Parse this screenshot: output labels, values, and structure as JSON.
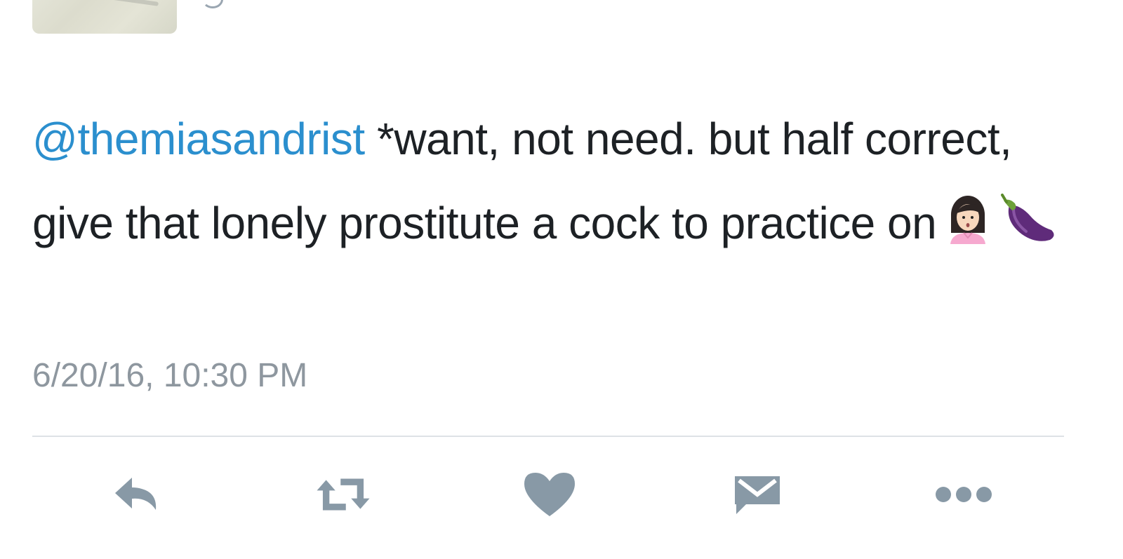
{
  "tweet": {
    "mention": "@themiasandrist",
    "body": " *want, not need. but half correct, give that lonely prostitute a cock to practice on",
    "emojis": [
      "woman-raising-hand-emoji",
      "eggplant-emoji"
    ],
    "timestamp": "6/20/16, 10:30 PM"
  },
  "actions": [
    {
      "icon": "reply-icon"
    },
    {
      "icon": "retweet-icon"
    },
    {
      "icon": "heart-icon"
    },
    {
      "icon": "direct-message-icon"
    },
    {
      "icon": "more-icon"
    }
  ],
  "colors": {
    "mention": "#2b8fce",
    "text": "#1d2125",
    "muted": "#8e979f",
    "icon": "#8899a6"
  }
}
